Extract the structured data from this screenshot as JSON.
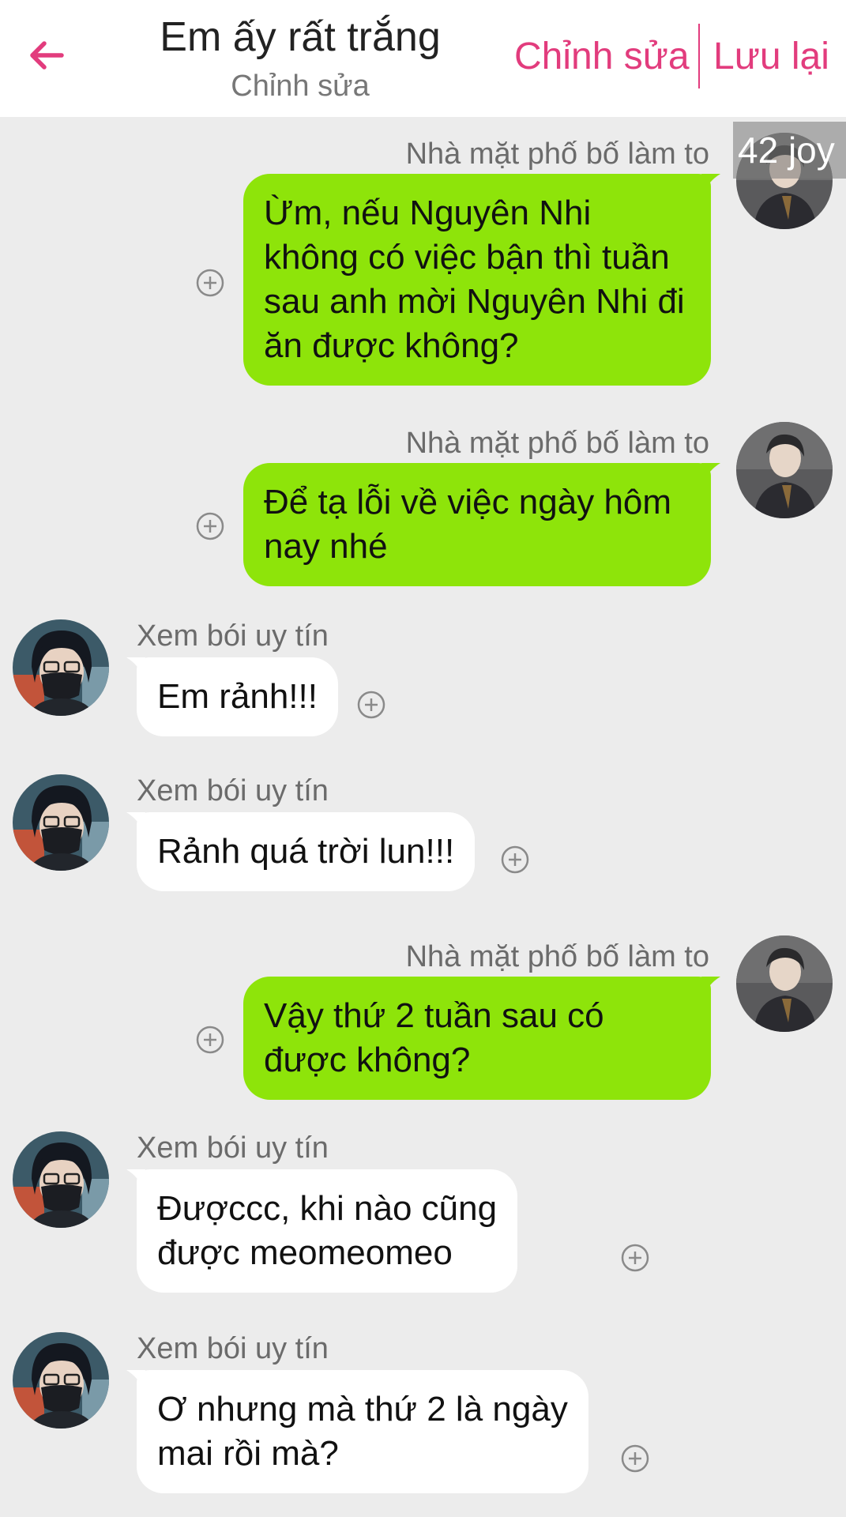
{
  "header": {
    "title": "Em ấy rất trắng",
    "subtitle": "Chỉnh sửa",
    "edit_label": "Chỉnh sửa",
    "save_label": "Lưu lại",
    "back_icon": "arrow-left-icon",
    "accent_color": "#e23c7d"
  },
  "badge": "42 joy",
  "colors": {
    "sent_bubble": "#8ee40a",
    "received_bubble": "#ffffff",
    "background": "#ececec"
  },
  "messages": [
    {
      "side": "right",
      "sender": "Nhà mặt phố bố làm to",
      "text": "Ừm, nếu Nguyên Nhi không có việc bận thì tuần sau anh mời Nguyên Nhi đi ăn được không?"
    },
    {
      "side": "right",
      "sender": "Nhà mặt phố bố làm to",
      "text": "Để tạ lỗi về việc ngày hôm nay nhé"
    },
    {
      "side": "left",
      "sender": "Xem bói uy tín",
      "text": "Em rảnh!!!"
    },
    {
      "side": "left",
      "sender": "Xem bói uy tín",
      "text": "Rảnh quá trời lun!!!"
    },
    {
      "side": "right",
      "sender": "Nhà mặt phố bố làm to",
      "text": "Vậy thứ 2 tuần sau có được không?"
    },
    {
      "side": "left",
      "sender": "Xem bói uy tín",
      "text": "Đượccc, khi nào cũng\nđược meomeomeo"
    },
    {
      "side": "left",
      "sender": "Xem bói uy tín",
      "text": "Ơ nhưng mà thứ 2 là ngày\nmai rồi mà?"
    }
  ]
}
